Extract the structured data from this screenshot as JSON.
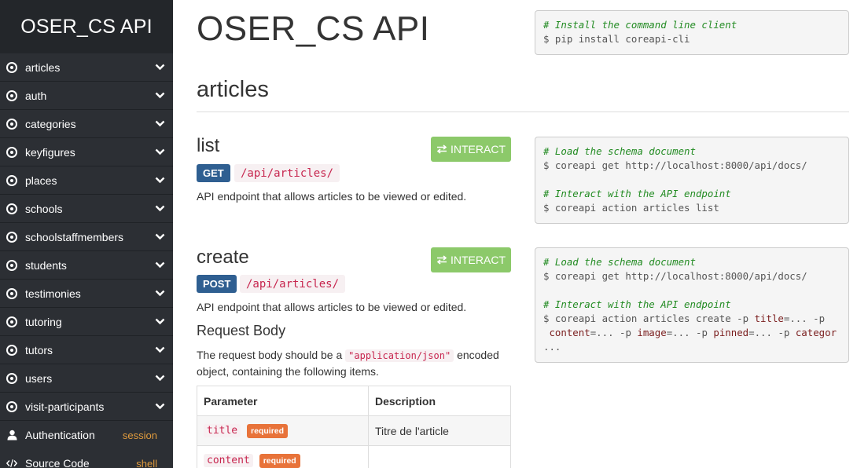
{
  "sidebar": {
    "brand": "OSER_CS API",
    "items": [
      {
        "label": "articles"
      },
      {
        "label": "auth"
      },
      {
        "label": "categories"
      },
      {
        "label": "keyfigures"
      },
      {
        "label": "places"
      },
      {
        "label": "schools"
      },
      {
        "label": "schoolstaffmembers"
      },
      {
        "label": "students"
      },
      {
        "label": "testimonies"
      },
      {
        "label": "tutoring"
      },
      {
        "label": "tutors"
      },
      {
        "label": "users"
      },
      {
        "label": "visit-participants"
      }
    ],
    "footer": {
      "authentication": {
        "label": "Authentication",
        "value": "session"
      },
      "source_code": {
        "label": "Source Code",
        "value": "shell"
      }
    }
  },
  "main": {
    "title": "OSER_CS API",
    "install_code": {
      "comment": "# Install the command line client",
      "command": "$ pip install coreapi-cli"
    },
    "section_title": "articles",
    "endpoints": [
      {
        "title": "list",
        "interact_label": "INTERACT",
        "method": "GET",
        "path": "/api/articles/",
        "description": "API endpoint that allows articles to be viewed or edited.",
        "code": {
          "comment1": "# Load the schema document",
          "cmd1": "$ coreapi get http://localhost:8000/api/docs/",
          "comment2": "# Interact with the API endpoint",
          "cmd2": "$ coreapi action articles list"
        }
      },
      {
        "title": "create",
        "interact_label": "INTERACT",
        "method": "POST",
        "path": "/api/articles/",
        "description": "API endpoint that allows articles to be viewed or edited.",
        "code": {
          "comment1": "# Load the schema document",
          "cmd1": "$ coreapi get http://localhost:8000/api/docs/",
          "comment2": "# Interact with the API endpoint",
          "cmd2a": "$ coreapi action articles create -p ",
          "cmd2b": "title",
          "cmd2c": "=... -p",
          "cmd3a": "content",
          "cmd3b": "=... -p ",
          "cmd3c": "image",
          "cmd3d": "=... -p ",
          "cmd3e": "pinned",
          "cmd3f": "=... -p ",
          "cmd3g": "categor",
          "cmd4": "..."
        },
        "request_body": {
          "title": "Request Body",
          "text_before": "The request body should be a ",
          "content_type": "\"application/json\"",
          "text_after": " encoded object, containing the following items.",
          "columns": [
            "Parameter",
            "Description"
          ],
          "rows": [
            {
              "name": "title",
              "required": "required",
              "description": "Titre de l'article"
            },
            {
              "name": "content",
              "required": "required",
              "description": ""
            }
          ]
        }
      }
    ]
  },
  "colors": {
    "sidebar_bg": "#2c2f34",
    "interact_green": "#8cc96a",
    "method_blue": "#2f5f91",
    "required_orange": "#e8733a",
    "footer_value": "#e09b3d"
  }
}
